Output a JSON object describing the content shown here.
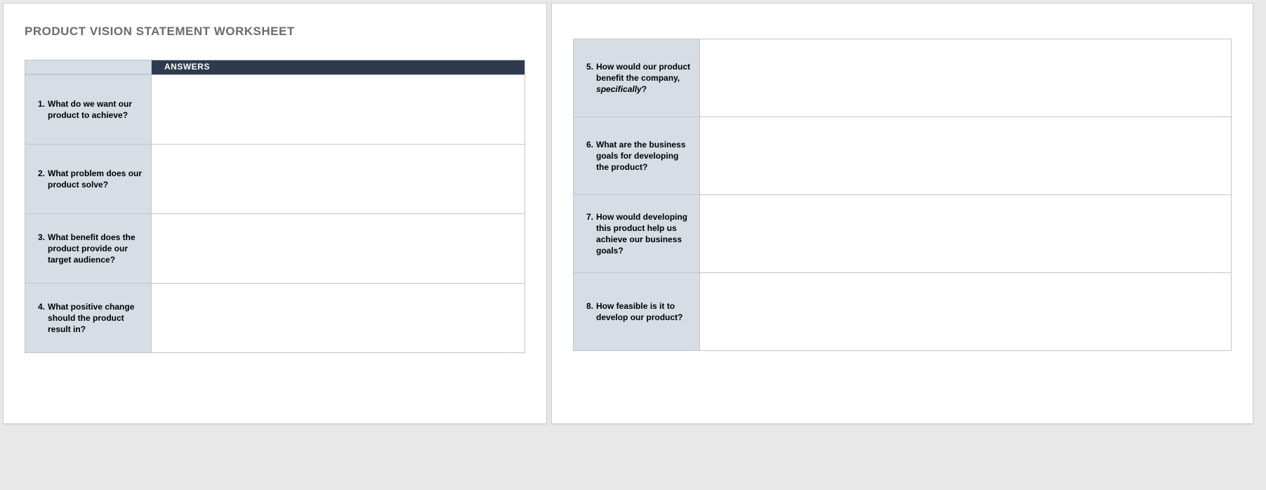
{
  "title": "PRODUCT VISION STATEMENT WORKSHEET",
  "headers": {
    "answers": "ANSWERS"
  },
  "questions_left": [
    {
      "num": "1.",
      "text": "What do we want our product to achieve?"
    },
    {
      "num": "2.",
      "text": "What problem does our product solve?"
    },
    {
      "num": "3.",
      "text": "What benefit does the product provide our target audience?"
    },
    {
      "num": "4.",
      "text": "What positive change should the product result in?"
    }
  ],
  "questions_right": [
    {
      "num": "5.",
      "text_pre": "How would our product benefit the company, ",
      "text_em": "specifically",
      "text_post": "?"
    },
    {
      "num": "6.",
      "text": "What are the business goals for developing the product?"
    },
    {
      "num": "7.",
      "text": "How would developing this product help us achieve our business goals?"
    },
    {
      "num": "8.",
      "text": " How feasible is it to develop our product?"
    }
  ],
  "answers_left": [
    "",
    "",
    "",
    ""
  ],
  "answers_right": [
    "",
    "",
    "",
    ""
  ]
}
